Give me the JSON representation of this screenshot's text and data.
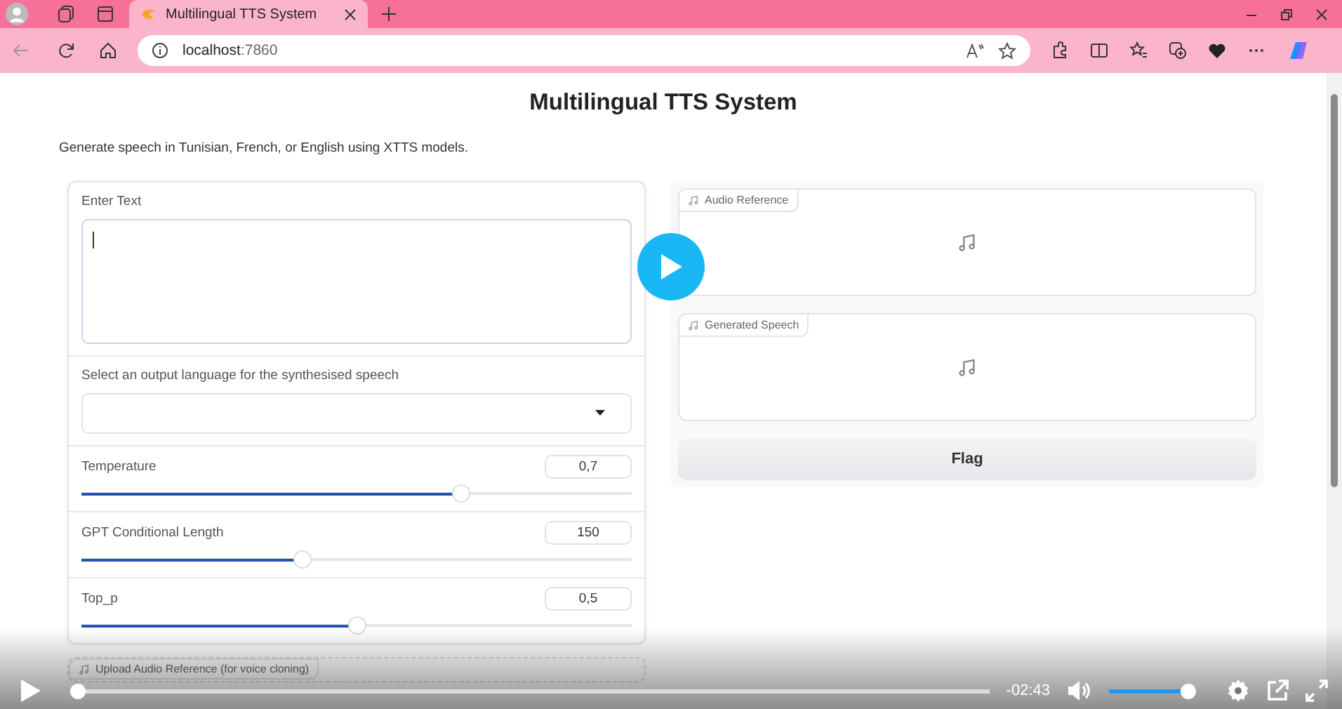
{
  "browser": {
    "tab": {
      "title": "Multilingual TTS System",
      "selected": true
    },
    "address": {
      "host": "localhost",
      "port": ":7860"
    }
  },
  "page": {
    "title": "Multilingual TTS System",
    "description": "Generate speech in Tunisian, French, or English using XTTS models.",
    "text_input": {
      "label": "Enter Text"
    },
    "language_select": {
      "label": "Select an output language for the synthesised speech"
    },
    "sliders": [
      {
        "label": "Temperature",
        "value": "0,7",
        "level": 0.69
      },
      {
        "label": "GPT Conditional Length",
        "value": "150",
        "level": 0.4
      },
      {
        "label": "Top_p",
        "value": "0,5",
        "level": 0.5
      }
    ],
    "upload": {
      "label": "Upload Audio Reference (for voice cloning)"
    },
    "audio_outputs": [
      {
        "label": "Audio Reference"
      },
      {
        "label": "Generated Speech"
      }
    ],
    "flag_button": "Flag"
  },
  "video_player": {
    "remaining": "-02:43",
    "progress": {
      "level": 0
    },
    "volume": {
      "level": 1
    }
  }
}
